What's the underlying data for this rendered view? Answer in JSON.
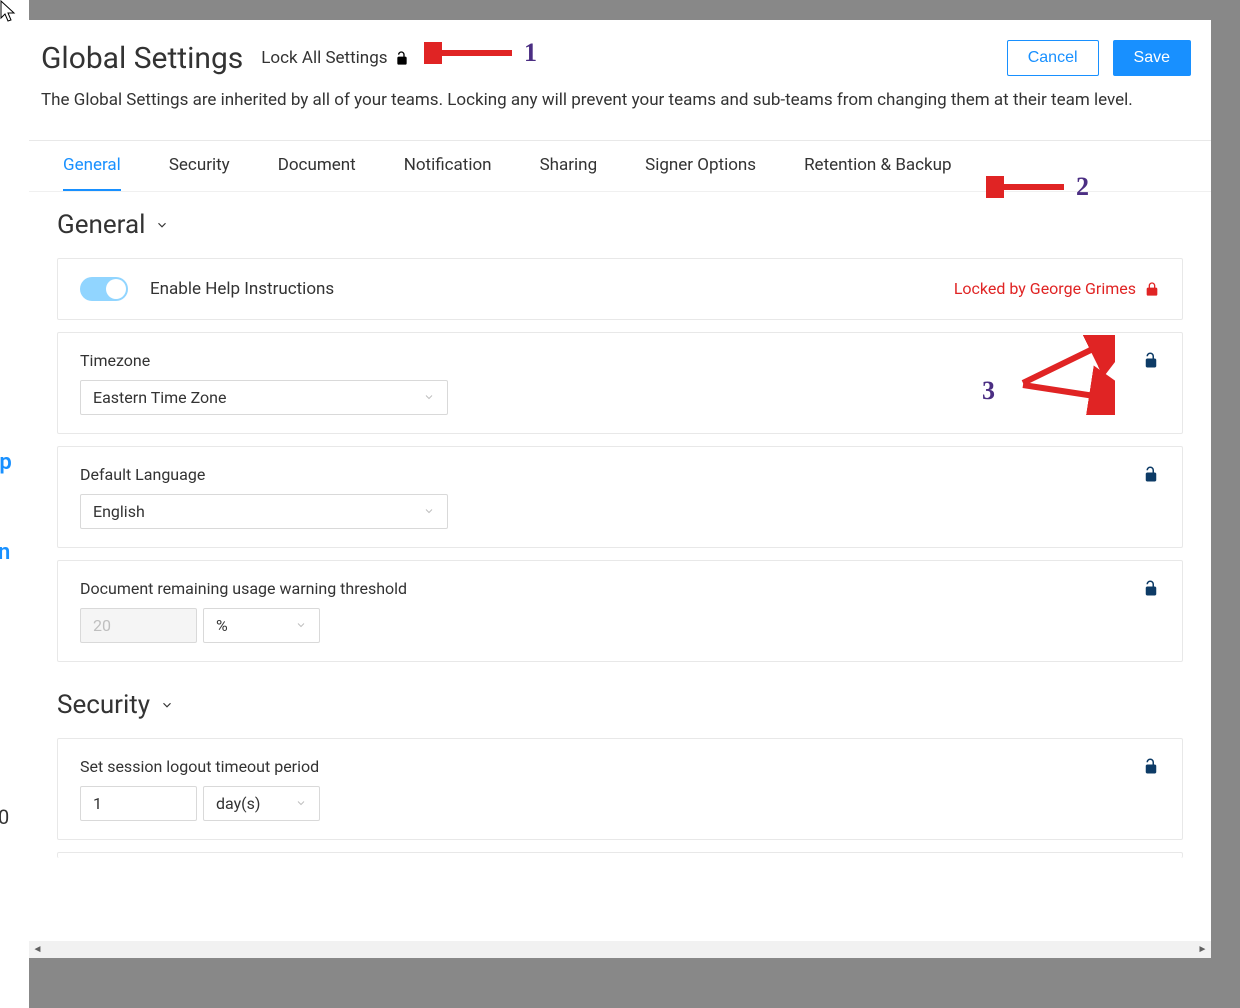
{
  "header": {
    "title": "Global Settings",
    "lock_all_label": "Lock All Settings",
    "cancel": "Cancel",
    "save": "Save",
    "description": "The Global Settings are inherited by all of your teams. Locking any will prevent your teams and sub-teams from changing them at their team level."
  },
  "tabs": [
    "General",
    "Security",
    "Document",
    "Notification",
    "Sharing",
    "Signer Options",
    "Retention & Backup"
  ],
  "active_tab": "General",
  "sections": {
    "general": {
      "title": "General",
      "enable_help": {
        "label": "Enable Help Instructions",
        "locked_by": "Locked by George Grimes"
      },
      "timezone": {
        "label": "Timezone",
        "value": "Eastern Time Zone"
      },
      "language": {
        "label": "Default Language",
        "value": "English"
      },
      "threshold": {
        "label": "Document remaining usage warning threshold",
        "value": "20",
        "unit": "%"
      }
    },
    "security": {
      "title": "Security",
      "session_timeout": {
        "label": "Set session logout timeout period",
        "value": "1",
        "unit": "day(s)"
      }
    }
  },
  "annotations": {
    "n1": "1",
    "n2": "2",
    "n3": "3"
  },
  "colors": {
    "primary": "#1890ff",
    "lock_red": "#e02424",
    "lock_navy": "#0d3b66",
    "anno_purple": "#4b2e83",
    "anno_red": "#e02424"
  }
}
